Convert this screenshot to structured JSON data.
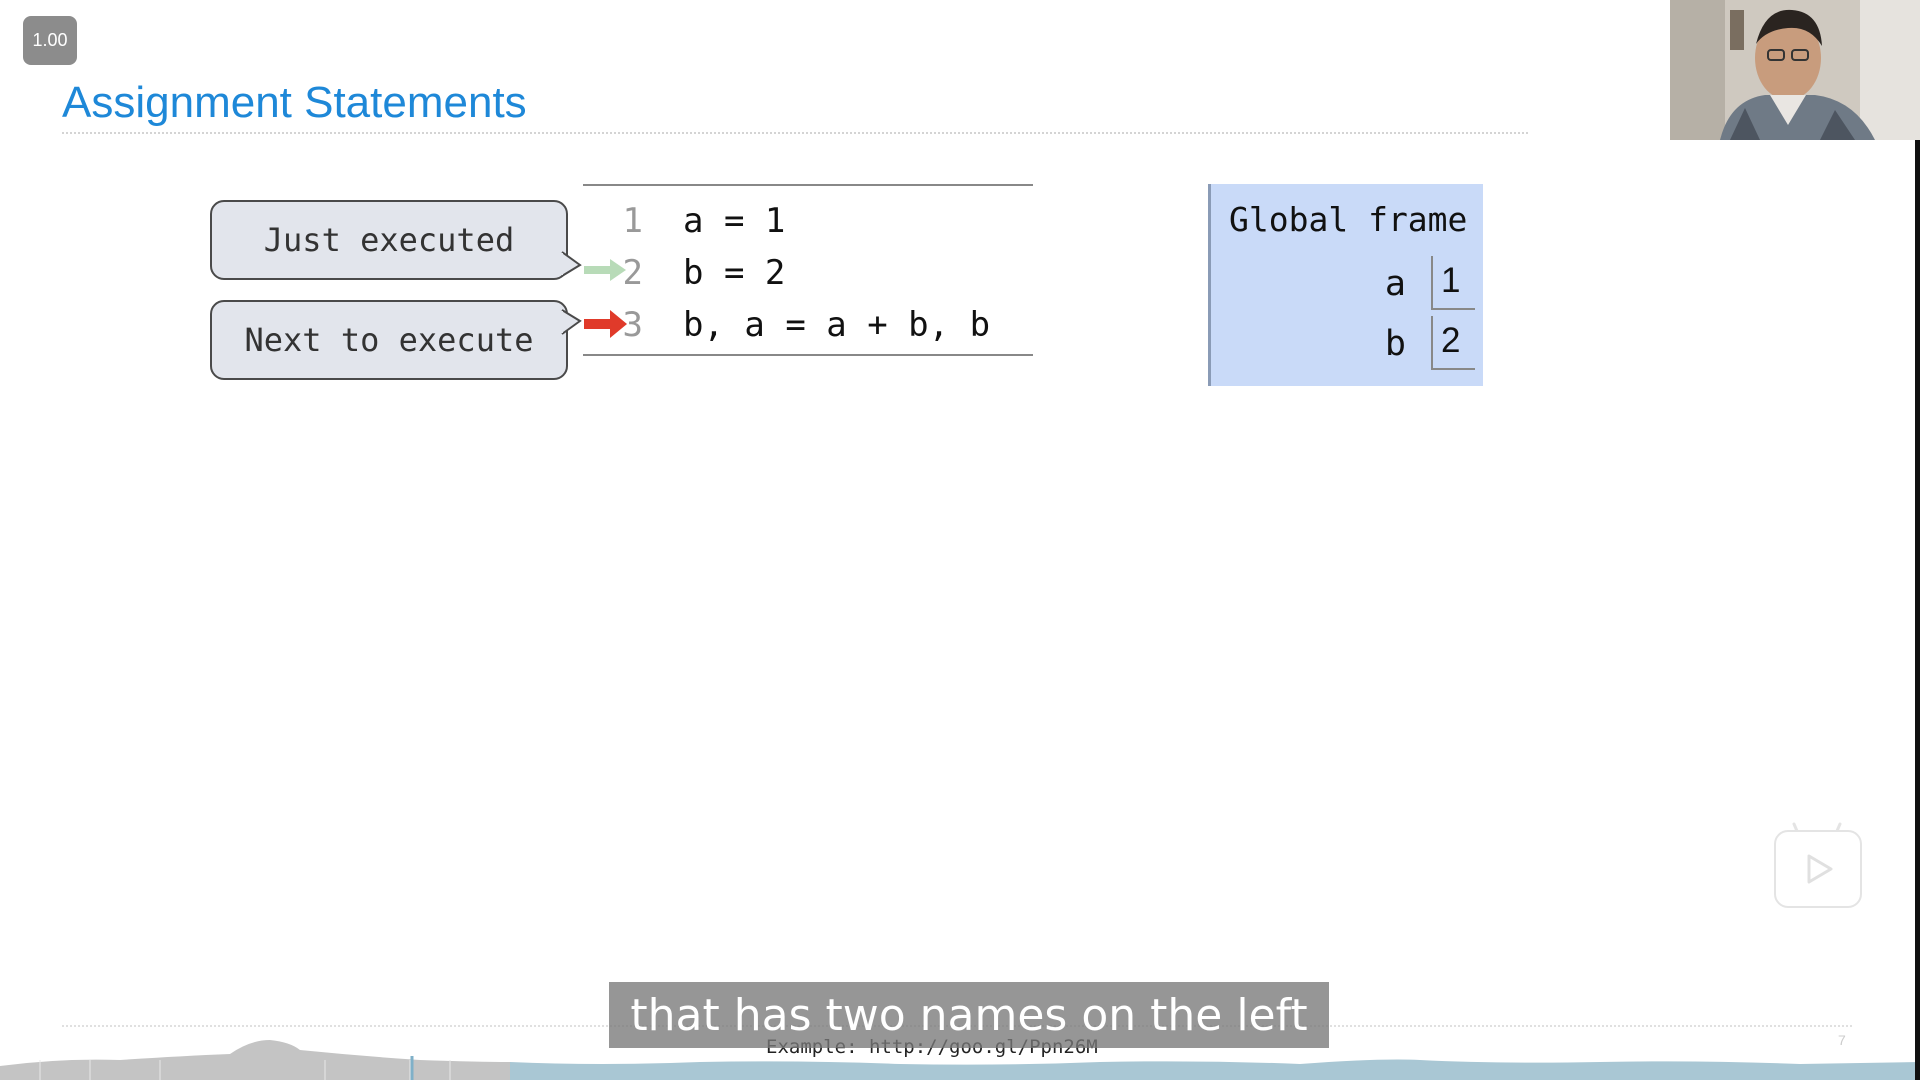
{
  "player": {
    "speed": "1.00",
    "page_number": "7"
  },
  "slide": {
    "title": "Assignment Statements",
    "callouts": {
      "just_executed": "Just executed",
      "next_to_execute": "Next to execute"
    },
    "code_lines": [
      {
        "num": "1",
        "code": "a = 1"
      },
      {
        "num": "2",
        "code": "b = 2"
      },
      {
        "num": "3",
        "code": "b, a = a + b, b"
      }
    ],
    "frame": {
      "title": "Global frame",
      "vars": [
        {
          "name": "a",
          "value": "1"
        },
        {
          "name": "b",
          "value": "2"
        }
      ]
    },
    "footer": {
      "example": "Example: http://goo.gl/Ppn26M"
    }
  },
  "subtitle": "that has two names on the left",
  "colors": {
    "title": "#1e88d8",
    "just_executed_arrow": "#b8dbb8",
    "next_arrow": "#e03a2a",
    "frame_bg": "#c9daf8"
  },
  "icons": {
    "play": "play-icon"
  }
}
